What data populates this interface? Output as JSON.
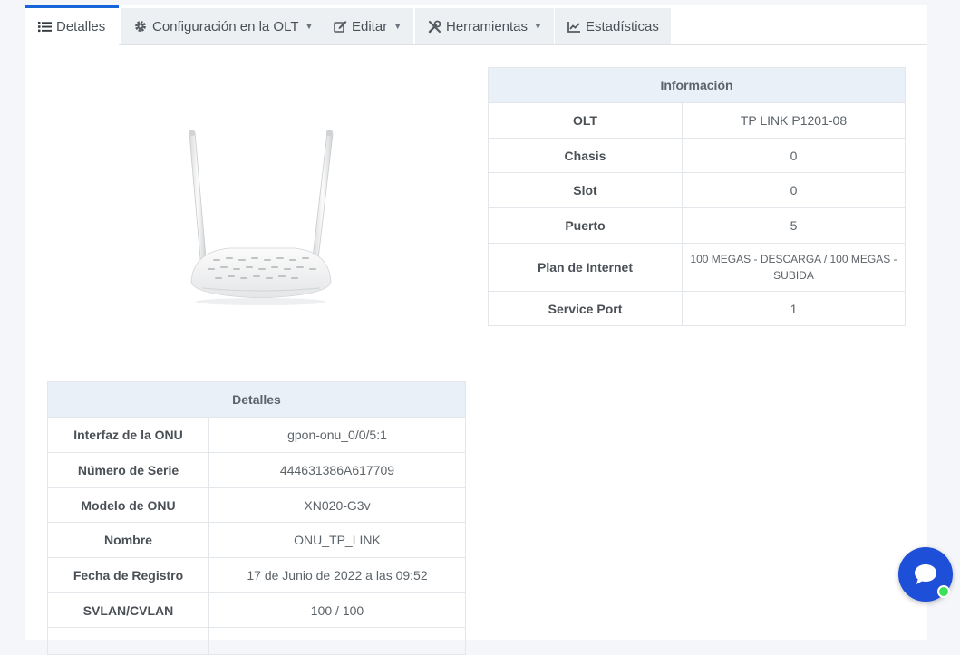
{
  "tabs": [
    {
      "label": "Detalles",
      "icon": "list-icon",
      "dropdown": false,
      "active": true
    },
    {
      "label": "Configuración en la OLT",
      "icon": "gear-icon",
      "dropdown": true,
      "active": false
    },
    {
      "label": "Editar",
      "icon": "edit-icon",
      "dropdown": true,
      "active": false
    },
    {
      "label": "Herramientas",
      "icon": "tools-icon",
      "dropdown": true,
      "active": false
    },
    {
      "label": "Estadísticas",
      "icon": "chart-icon",
      "dropdown": false,
      "active": false
    }
  ],
  "info": {
    "title": "Información",
    "rows": [
      {
        "key": "OLT",
        "value": "TP LINK P1201-08"
      },
      {
        "key": "Chasis",
        "value": "0"
      },
      {
        "key": "Slot",
        "value": "0"
      },
      {
        "key": "Puerto",
        "value": "5"
      },
      {
        "key": "Plan de Internet",
        "value": "100 MEGAS - DESCARGA / 100 MEGAS - SUBIDA"
      },
      {
        "key": "Service Port",
        "value": "1"
      }
    ]
  },
  "details": {
    "title": "Detalles",
    "rows": [
      {
        "key": "Interfaz de la ONU",
        "value": "gpon-onu_0/0/5:1"
      },
      {
        "key": "Número de Serie",
        "value": "444631386A617709"
      },
      {
        "key": "Modelo de ONU",
        "value": "XN020-G3v"
      },
      {
        "key": "Nombre",
        "value": "ONU_TP_LINK"
      },
      {
        "key": "Fecha de Registro",
        "value": "17 de Junio de 2022 a las 09:52"
      },
      {
        "key": "SVLAN/CVLAN",
        "value": "100 / 100"
      }
    ]
  },
  "colors": {
    "accent": "#1565d8",
    "chat_button": "#1d4fd8",
    "online_dot": "#3ce05a",
    "table_header_bg": "#eaf0f8"
  },
  "chat_icon": "chat-bubble-icon",
  "device_image": "onu-router-image"
}
